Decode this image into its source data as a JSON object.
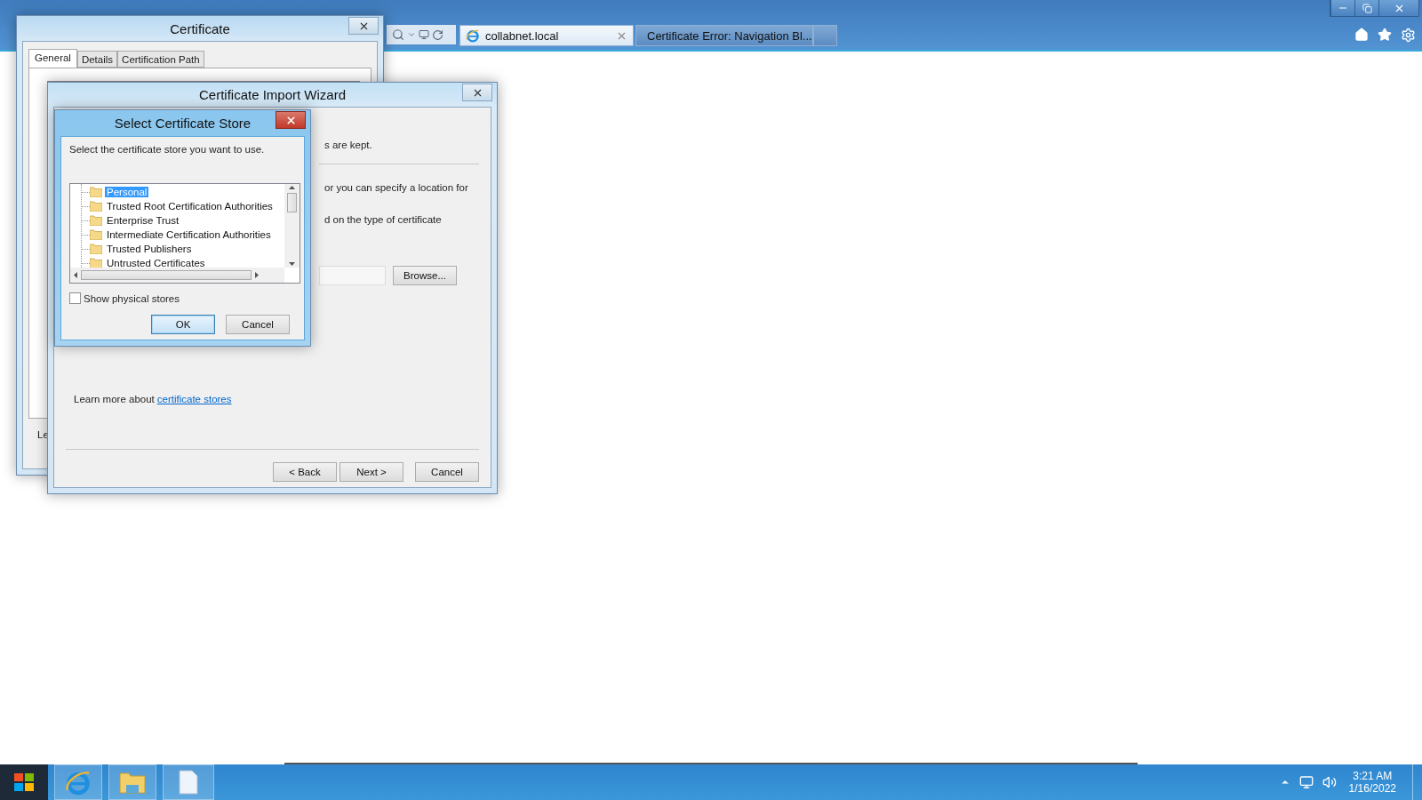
{
  "browser": {
    "tabs": [
      {
        "label": "collabnet.local",
        "selected": true
      },
      {
        "label": "Certificate Error: Navigation Bl...",
        "selected": false
      }
    ]
  },
  "certificate_window": {
    "title": "Certificate",
    "tabs": [
      {
        "label": "General",
        "selected": true
      },
      {
        "label": "Details",
        "selected": false
      },
      {
        "label": "Certification Path",
        "selected": false
      }
    ],
    "footer_text": "Le"
  },
  "import_wizard": {
    "title": "Certificate Import Wizard",
    "texts": [
      "s are kept.",
      "or you can specify a location for",
      "d on the type of certificate"
    ],
    "browse_button": "Browse...",
    "learn_more": {
      "text": "Learn more about",
      "link": "certificate stores"
    },
    "buttons": [
      "< Back",
      "Next >",
      "Cancel"
    ]
  },
  "store_dialog": {
    "title": "Select Certificate Store",
    "instruction": "Select the certificate store you want to use.",
    "stores": [
      {
        "label": "Personal",
        "selected": true
      },
      {
        "label": "Trusted Root Certification Authorities",
        "selected": false
      },
      {
        "label": "Enterprise Trust",
        "selected": false
      },
      {
        "label": "Intermediate Certification Authorities",
        "selected": false
      },
      {
        "label": "Trusted Publishers",
        "selected": false
      },
      {
        "label": "Untrusted Certificates",
        "selected": false
      }
    ],
    "show_physical": {
      "label": "Show physical stores",
      "checked": false
    },
    "buttons": [
      {
        "label": "OK",
        "default": true
      },
      {
        "label": "Cancel",
        "default": false
      }
    ]
  },
  "taskbar": {
    "time": "3:21 AM",
    "date": "1/16/2022"
  }
}
